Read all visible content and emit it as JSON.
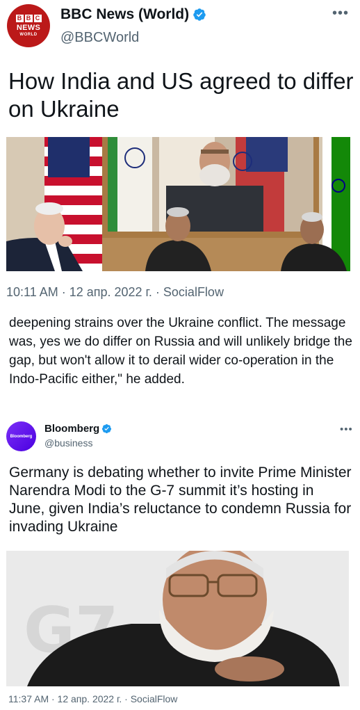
{
  "tweet1": {
    "avatar": {
      "blocks": [
        "B",
        "B",
        "C"
      ],
      "line1": "NEWS",
      "line2": "WORLD"
    },
    "author_name": "BBC News (World)",
    "handle": "@BBCWorld",
    "headline": "How India and US agreed to differ on Ukraine",
    "timestamp": "10:11 AM · 12 апр. 2022 г. · SocialFlow",
    "quoted_text": "deepening strains over the Ukraine conflict. The message was, yes we do differ on Russia and will unlikely bridge the gap, but won't allow it to derail wider co-operation in the Indo-Pacific either,\" he added."
  },
  "tweet2": {
    "avatar_text": "Bloomberg",
    "author_name": "Bloomberg",
    "handle": "@business",
    "text": "Germany is debating whether to invite Prime Minister Narendra Modi to the G-7 summit it’s hosting in June, given India’s reluctance to condemn Russia for invading Ukraine",
    "background_logo": "G7",
    "timestamp": "11:37 AM · 12 апр. 2022 г. · SocialFlow"
  },
  "colors": {
    "text": "#0f1419",
    "secondary": "#536471",
    "verified": "#1d9bf0",
    "bbc_red": "#bb1919",
    "bloomberg_purple": "#6a1ff0"
  },
  "icons": [
    "verified-badge-icon",
    "more-options-icon"
  ]
}
